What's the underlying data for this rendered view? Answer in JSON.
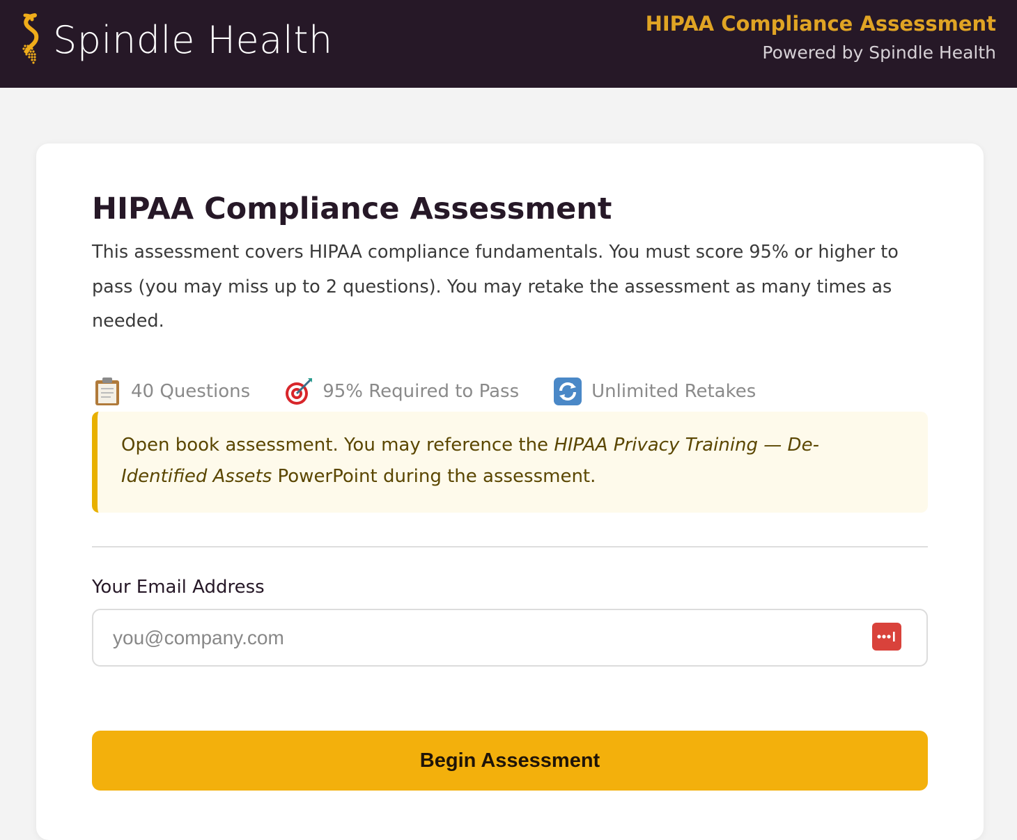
{
  "header": {
    "brand": "Spindle Health",
    "logo_icon": "spindle-logo-icon",
    "title": "HIPAA Compliance Assessment",
    "subtitle": "Powered by Spindle Health"
  },
  "card": {
    "title": "HIPAA Compliance Assessment",
    "description": "This assessment covers HIPAA compliance fundamentals. You must score 95% or higher to pass (you may miss up to 2 questions). You may retake the assessment as many times as needed.",
    "stats": [
      {
        "icon": "clipboard-icon",
        "label": "40 Questions"
      },
      {
        "icon": "target-icon",
        "label": "95% Required to Pass"
      },
      {
        "icon": "refresh-icon",
        "label": "Unlimited Retakes"
      }
    ],
    "notice": {
      "prefix": "Open book assessment. You may reference the ",
      "emphasis": "HIPAA Privacy Training — De-Identified Assets",
      "suffix": " PowerPoint during the assessment."
    },
    "email": {
      "label": "Your Email Address",
      "placeholder": "you@company.com",
      "value": "",
      "autofill_icon": "password-manager-icon"
    },
    "begin_button": "Begin Assessment"
  },
  "colors": {
    "header_bg": "#261827",
    "accent_gold": "#e0a424",
    "button": "#f3b00c",
    "notice_bg": "#fefaeb",
    "notice_border": "#e8b000"
  }
}
